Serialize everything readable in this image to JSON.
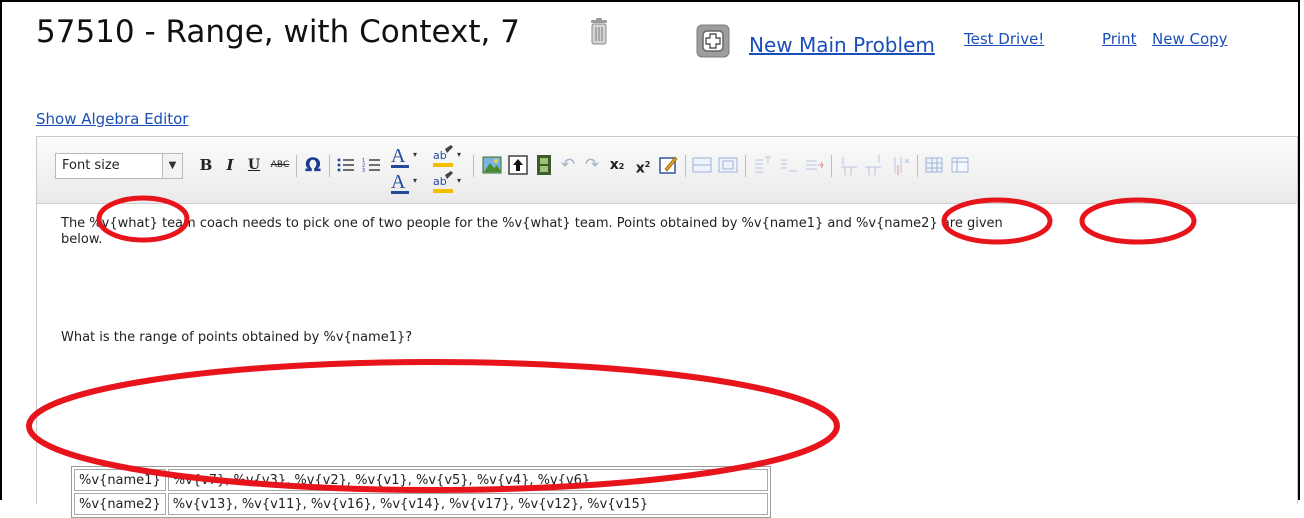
{
  "header": {
    "title": "57510 - Range, with Context, 7",
    "new_main_problem": "New Main Problem",
    "test_drive": "Test Drive!",
    "print": "Print",
    "new_copy": "New Copy"
  },
  "show_algebra_editor": "Show Algebra Editor",
  "toolbar": {
    "font_size": "Font size",
    "items": [
      "B",
      "I",
      "U",
      "ABC",
      "Ω",
      "bulleted-list",
      "numbered-list",
      "text-color",
      "highlight-color",
      "image",
      "upload",
      "media",
      "undo",
      "redo",
      "subscript",
      "superscript",
      "edit",
      "table-tools"
    ]
  },
  "content": {
    "paragraph_line1": "The %v{what} team coach needs to pick one of two people for the %v{what} team. Points obtained by %v{name1} and %v{name2} are given",
    "paragraph_line2": "below.",
    "question": "What is the range of points obtained by %v{name1}?",
    "table": [
      [
        "%v{name1}",
        "%v{v7}, %v{v3}, %v{v2}, %v{v1}, %v{v5}, %v{v4}, %v{v6}"
      ],
      [
        "%v{name2}",
        "%v{v13}, %v{v11}, %v{v16}, %v{v14}, %v{v17}, %v{v12}, %v{v15}"
      ]
    ]
  },
  "colors": {
    "link": "#1a4fb8",
    "highlight_ellipse": "#e8141b"
  }
}
